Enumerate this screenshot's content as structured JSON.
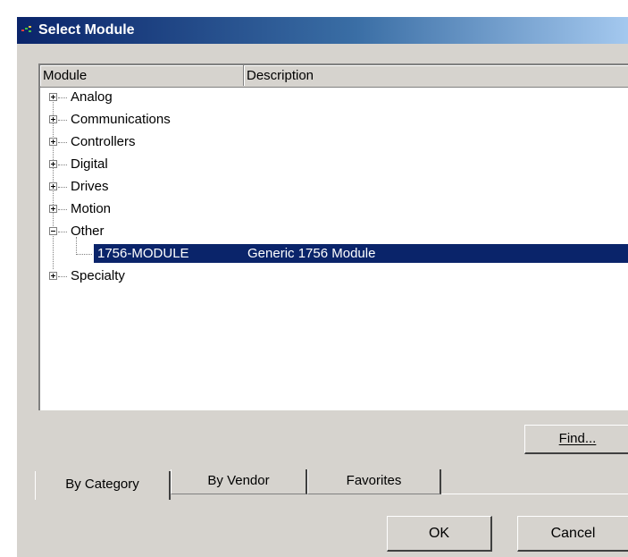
{
  "window": {
    "title": "Select Module"
  },
  "list": {
    "columns": {
      "module": "Module",
      "description": "Description"
    },
    "categories": [
      {
        "label": "Analog",
        "expanded": false
      },
      {
        "label": "Communications",
        "expanded": false
      },
      {
        "label": "Controllers",
        "expanded": false
      },
      {
        "label": "Digital",
        "expanded": false
      },
      {
        "label": "Drives",
        "expanded": false
      },
      {
        "label": "Motion",
        "expanded": false
      },
      {
        "label": "Other",
        "expanded": true,
        "children": [
          {
            "module": "1756-MODULE",
            "description": "Generic 1756 Module",
            "selected": true
          }
        ]
      },
      {
        "label": "Specialty",
        "expanded": false
      }
    ]
  },
  "buttons": {
    "find": "Find...",
    "ok": "OK",
    "cancel": "Cancel"
  },
  "tabs": [
    {
      "label": "By Category",
      "active": true
    },
    {
      "label": "By Vendor",
      "active": false
    },
    {
      "label": "Favorites",
      "active": false
    }
  ],
  "colors": {
    "selection": "#0a246a",
    "dialog_bg": "#d6d3ce",
    "title_start": "#0a246a",
    "title_end": "#a6caf0"
  }
}
